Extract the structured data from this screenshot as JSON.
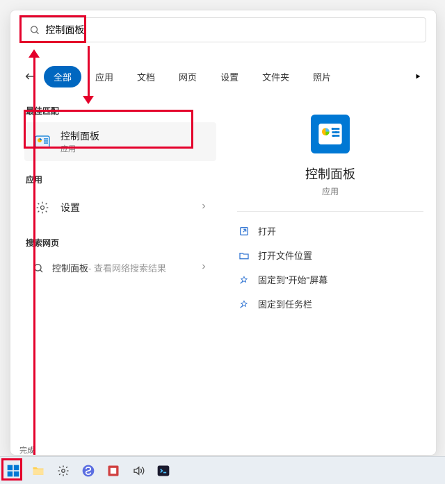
{
  "search": {
    "value": "控制面板"
  },
  "tabs": {
    "all": "全部",
    "apps": "应用",
    "docs": "文档",
    "web": "网页",
    "settings": "设置",
    "folders": "文件夹",
    "photos": "照片"
  },
  "sections": {
    "best_match": "最佳匹配",
    "apps": "应用",
    "search_web": "搜索网页"
  },
  "best_match": {
    "title": "控制面板",
    "subtitle": "应用"
  },
  "apps_list": {
    "settings": {
      "title": "设置"
    }
  },
  "web": {
    "query": "控制面板",
    "hint": " - 查看网络搜索结果"
  },
  "preview": {
    "name": "控制面板",
    "subtitle": "应用",
    "actions": {
      "open": "打开",
      "open_location": "打开文件位置",
      "pin_start": "固定到\"开始\"屏幕",
      "pin_taskbar": "固定到任务栏"
    }
  },
  "status": "完成"
}
